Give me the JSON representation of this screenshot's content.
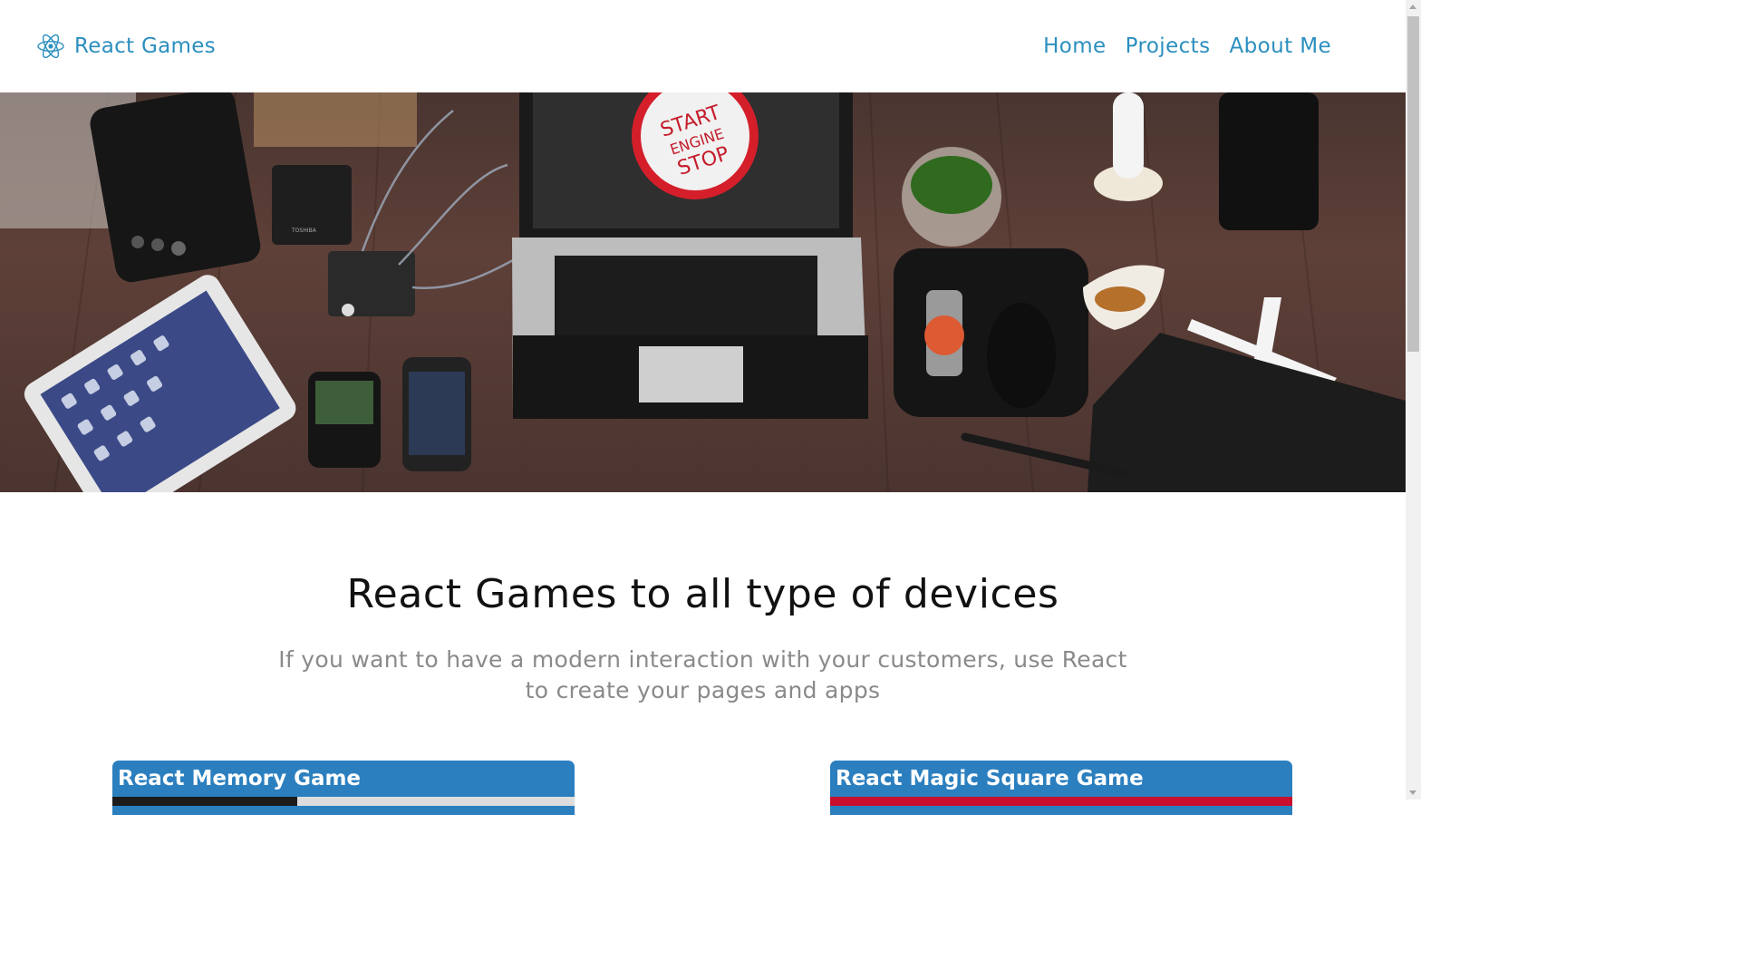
{
  "navbar": {
    "brand": "React Games",
    "links": [
      "Home",
      "Projects",
      "About Me"
    ]
  },
  "hero": {
    "button_text": [
      "START",
      "ENGINE",
      "STOP"
    ],
    "drive_brand": "TOSHIBA"
  },
  "main": {
    "title": "React Games to all type of devices",
    "subtitle": "If you want to have a modern interaction with your customers, use React to create your pages and apps"
  },
  "cards": [
    {
      "title": "React Memory Game"
    },
    {
      "title": "React Magic Square Game"
    }
  ],
  "colors": {
    "accent": "#2b8fbf",
    "card_header": "#2b7fbf",
    "title": "#111111",
    "subtitle": "#8a8a8a"
  },
  "icons": {
    "brand": "react-atom-icon"
  }
}
